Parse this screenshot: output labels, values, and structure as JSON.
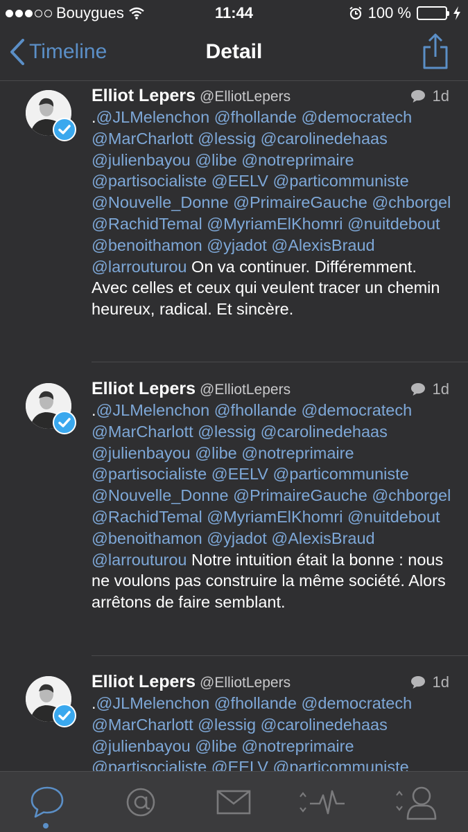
{
  "status_bar": {
    "carrier": "Bouygues",
    "time": "11:44",
    "battery": "100 %",
    "signal_bars_filled": 3,
    "signal_bars_total": 5
  },
  "nav": {
    "back_label": "Timeline",
    "title": "Detail"
  },
  "tweets": [
    {
      "name": "Elliot Lepers",
      "handle": "@ElliotLepers",
      "age": "1d",
      "prefix": ".",
      "mentions": "@JLMelenchon @fhollande @democratech @MarCharlott @lessig @carolinedehaas @julienbayou @libe @notreprimaire @partisocialiste @EELV @particommuniste @Nouvelle_Donne @PrimaireGauche @chborgel @RachidTemal @MyriamElKhomri @nuitdebout @benoithamon @yjadot @AlexisBraud @larrouturou",
      "text": "On va continuer. Différemment. Avec celles et ceux qui veulent tracer un chemin heureux, radical. Et sincère."
    },
    {
      "name": "Elliot Lepers",
      "handle": "@ElliotLepers",
      "age": "1d",
      "prefix": ".",
      "mentions": "@JLMelenchon @fhollande @democratech @MarCharlott @lessig @carolinedehaas @julienbayou @libe @notreprimaire @partisocialiste @EELV @particommuniste @Nouvelle_Donne @PrimaireGauche @chborgel @RachidTemal @MyriamElKhomri @nuitdebout @benoithamon @yjadot @AlexisBraud @larrouturou",
      "text": "Notre intuition était la bonne : nous ne voulons pas construire la même société. Alors arrêtons de faire semblant."
    },
    {
      "name": "Elliot Lepers",
      "handle": "@ElliotLepers",
      "age": "1d",
      "prefix": ".",
      "mentions": "@JLMelenchon @fhollande @democratech @MarCharlott @lessig @carolinedehaas @julienbayou @libe @notreprimaire @partisocialiste @EELV @particommuniste",
      "text": ""
    }
  ],
  "tabs": [
    {
      "icon": "speech-bubble-icon",
      "active": true
    },
    {
      "icon": "at-sign-icon",
      "active": false
    },
    {
      "icon": "envelope-icon",
      "active": false
    },
    {
      "icon": "activity-pulse-icon",
      "active": false
    },
    {
      "icon": "profile-icon",
      "active": false
    }
  ],
  "colors": {
    "background": "#2f2f31",
    "accent": "#5b8fc7",
    "mention": "#7ea8d8",
    "verified": "#3aa8ee",
    "battery": "#4cd964",
    "tabbar": "#3b3b3d"
  }
}
